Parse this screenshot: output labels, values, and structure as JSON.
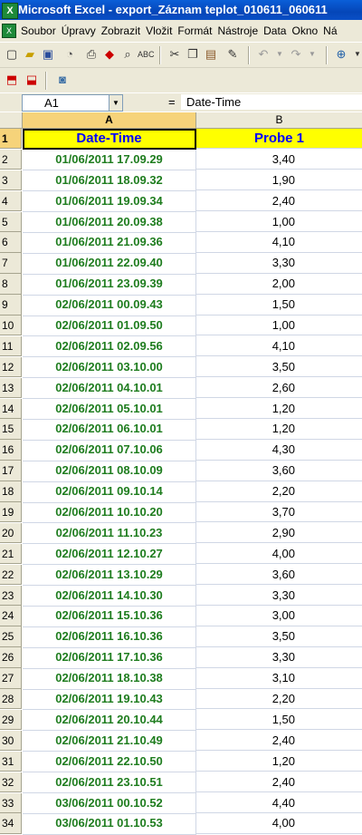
{
  "window": {
    "title": "Microsoft Excel - export_Záznam teplot_010611_060611"
  },
  "menu": [
    "Soubor",
    "Úpravy",
    "Zobrazit",
    "Vložit",
    "Formát",
    "Nástroje",
    "Data",
    "Okno",
    "Ná"
  ],
  "toolbar": {
    "icons": [
      "new-file-icon",
      "open-folder-icon",
      "save-icon",
      "permission-icon",
      "print-icon",
      "research-icon",
      "print-preview-icon",
      "spelling-icon",
      "cut-icon",
      "copy-icon",
      "paste-icon",
      "format-painter-icon",
      "undo-icon",
      "redo-icon",
      "hyperlink-icon"
    ],
    "pdf_icons": [
      "pdf-icon",
      "pdf-secure-icon",
      "acrobat-comment-icon"
    ]
  },
  "formula_bar": {
    "name_box": "A1",
    "equals": "=",
    "content": "Date-Time"
  },
  "columns": [
    "A",
    "B"
  ],
  "header": {
    "row": "1",
    "a": "Date-Time",
    "b": "Probe 1"
  },
  "rows": [
    {
      "n": "2",
      "a": "01/06/2011 17.09.29",
      "b": "3,40"
    },
    {
      "n": "3",
      "a": "01/06/2011 18.09.32",
      "b": "1,90"
    },
    {
      "n": "4",
      "a": "01/06/2011 19.09.34",
      "b": "2,40"
    },
    {
      "n": "5",
      "a": "01/06/2011 20.09.38",
      "b": "1,00"
    },
    {
      "n": "6",
      "a": "01/06/2011 21.09.36",
      "b": "4,10"
    },
    {
      "n": "7",
      "a": "01/06/2011 22.09.40",
      "b": "3,30"
    },
    {
      "n": "8",
      "a": "01/06/2011 23.09.39",
      "b": "2,00"
    },
    {
      "n": "9",
      "a": "02/06/2011 00.09.43",
      "b": "1,50"
    },
    {
      "n": "10",
      "a": "02/06/2011 01.09.50",
      "b": "1,00"
    },
    {
      "n": "11",
      "a": "02/06/2011 02.09.56",
      "b": "4,10"
    },
    {
      "n": "12",
      "a": "02/06/2011 03.10.00",
      "b": "3,50"
    },
    {
      "n": "13",
      "a": "02/06/2011 04.10.01",
      "b": "2,60"
    },
    {
      "n": "14",
      "a": "02/06/2011 05.10.01",
      "b": "1,20"
    },
    {
      "n": "15",
      "a": "02/06/2011 06.10.01",
      "b": "1,20"
    },
    {
      "n": "16",
      "a": "02/06/2011 07.10.06",
      "b": "4,30"
    },
    {
      "n": "17",
      "a": "02/06/2011 08.10.09",
      "b": "3,60"
    },
    {
      "n": "18",
      "a": "02/06/2011 09.10.14",
      "b": "2,20"
    },
    {
      "n": "19",
      "a": "02/06/2011 10.10.20",
      "b": "3,70"
    },
    {
      "n": "20",
      "a": "02/06/2011 11.10.23",
      "b": "2,90"
    },
    {
      "n": "21",
      "a": "02/06/2011 12.10.27",
      "b": "4,00"
    },
    {
      "n": "22",
      "a": "02/06/2011 13.10.29",
      "b": "3,60"
    },
    {
      "n": "23",
      "a": "02/06/2011 14.10.30",
      "b": "3,30"
    },
    {
      "n": "24",
      "a": "02/06/2011 15.10.36",
      "b": "3,00"
    },
    {
      "n": "25",
      "a": "02/06/2011 16.10.36",
      "b": "3,50"
    },
    {
      "n": "26",
      "a": "02/06/2011 17.10.36",
      "b": "3,30"
    },
    {
      "n": "27",
      "a": "02/06/2011 18.10.38",
      "b": "3,10"
    },
    {
      "n": "28",
      "a": "02/06/2011 19.10.43",
      "b": "2,20"
    },
    {
      "n": "29",
      "a": "02/06/2011 20.10.44",
      "b": "1,50"
    },
    {
      "n": "30",
      "a": "02/06/2011 21.10.49",
      "b": "2,40"
    },
    {
      "n": "31",
      "a": "02/06/2011 22.10.50",
      "b": "1,20"
    },
    {
      "n": "32",
      "a": "02/06/2011 23.10.51",
      "b": "2,40"
    },
    {
      "n": "33",
      "a": "03/06/2011 00.10.52",
      "b": "4,40"
    },
    {
      "n": "34",
      "a": "03/06/2011 01.10.53",
      "b": "4,00"
    }
  ]
}
